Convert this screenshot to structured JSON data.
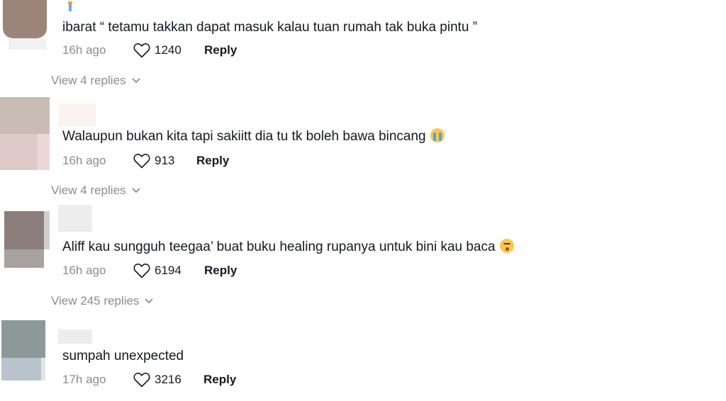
{
  "comments": [
    {
      "text": "ibarat “ tetamu takkan dapat masuk kalau tuan rumah tak buka pintu ”",
      "time": "16h ago",
      "likes": "1240",
      "reply_label": "Reply",
      "view_replies": "View 4 replies"
    },
    {
      "text": "Walaupun bukan kita tapi sakiitt dia tu tk boleh bawa bincang",
      "emoji": "loudly-crying-face",
      "time": "16h ago",
      "likes": "913",
      "reply_label": "Reply",
      "view_replies": "View 4 replies"
    },
    {
      "text": "Aliff kau sungguh teegaa’ buat buku healing rupanya untuk bini kau baca",
      "emoji": "flushed-face",
      "time": "16h ago",
      "likes": "6194",
      "reply_label": "Reply",
      "view_replies": "View 245 replies"
    },
    {
      "text": "sumpah unexpected",
      "time": "17h ago",
      "likes": "3216",
      "reply_label": "Reply"
    }
  ],
  "colors": {
    "text": "#161823",
    "secondary": "#8a8b91"
  },
  "icons": {
    "like": "heart-outline-icon",
    "expand": "chevron-down-icon"
  }
}
